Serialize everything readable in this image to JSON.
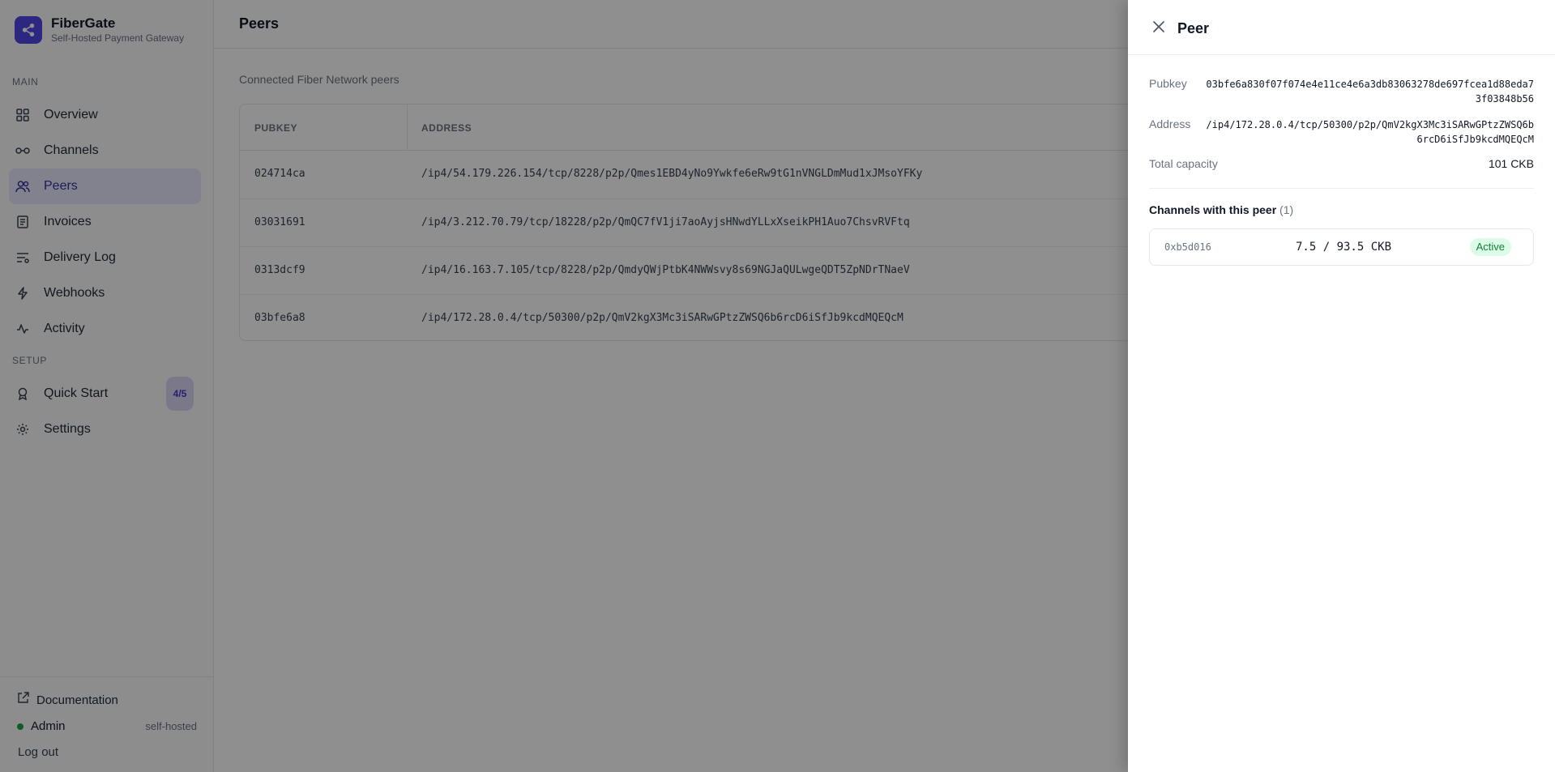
{
  "brand": {
    "name": "FiberGate",
    "subtitle": "Self-Hosted Payment Gateway"
  },
  "sidebar": {
    "section_main": "MAIN",
    "section_setup": "SETUP",
    "items": [
      {
        "label": "Overview",
        "icon": "grid-icon"
      },
      {
        "label": "Channels",
        "icon": "link-icon"
      },
      {
        "label": "Peers",
        "icon": "users-icon",
        "active": true
      },
      {
        "label": "Invoices",
        "icon": "document-icon"
      },
      {
        "label": "Delivery Log",
        "icon": "list-filter-icon"
      },
      {
        "label": "Webhooks",
        "icon": "lightning-icon"
      },
      {
        "label": "Activity",
        "icon": "pulse-icon"
      }
    ],
    "setup_items": [
      {
        "label": "Quick Start",
        "icon": "rocket-icon",
        "badge": "4/5"
      },
      {
        "label": "Settings",
        "icon": "gear-icon"
      }
    ],
    "footer": {
      "documentation": "Documentation",
      "user": "Admin",
      "user_tag": "self-hosted",
      "logout": "Log out"
    }
  },
  "main": {
    "title": "Peers",
    "subtitle": "Connected Fiber Network peers",
    "columns": [
      "PUBKEY",
      "ADDRESS"
    ],
    "rows": [
      {
        "pubkey": "024714ca",
        "address": "/ip4/54.179.226.154/tcp/8228/p2p/Qmes1EBD4yNo9Ywkfe6eRw9tG1nVNGLDmMud1xJMsoYFKy"
      },
      {
        "pubkey": "03031691",
        "address": "/ip4/3.212.70.79/tcp/18228/p2p/QmQC7fV1ji7aoAyjsHNwdYLLxXseikPH1Auo7ChsvRVFtq"
      },
      {
        "pubkey": "0313dcf9",
        "address": "/ip4/16.163.7.105/tcp/8228/p2p/QmdyQWjPtbK4NWWsvy8s69NGJaQULwgeQDT5ZpNDrTNaeV"
      },
      {
        "pubkey": "03bfe6a8",
        "address": "/ip4/172.28.0.4/tcp/50300/p2p/QmV2kgX3Mc3iSARwGPtzZWSQ6b6rcD6iSfJb9kcdMQEQcM"
      }
    ]
  },
  "drawer": {
    "title": "Peer",
    "pubkey_label": "Pubkey",
    "pubkey_value": "03bfe6a830f07f074e4e11ce4e6a3db83063278de697fcea1d88eda73f03848b56",
    "address_label": "Address",
    "address_value": "/ip4/172.28.0.4/tcp/50300/p2p/QmV2kgX3Mc3iSARwGPtzZWSQ6b6rcD6iSfJb9kcdMQEQcM",
    "capacity_label": "Total capacity",
    "capacity_value": "101 CKB",
    "channels_title": "Channels with this peer",
    "channels_count": "(1)",
    "channels": [
      {
        "id": "0xb5d016",
        "balance": "7.5 / 93.5 CKB",
        "status": "Active"
      }
    ]
  },
  "colors": {
    "accent": "#4f46e5",
    "active_bg": "#e7e8fb",
    "status_active": "#15803d"
  }
}
